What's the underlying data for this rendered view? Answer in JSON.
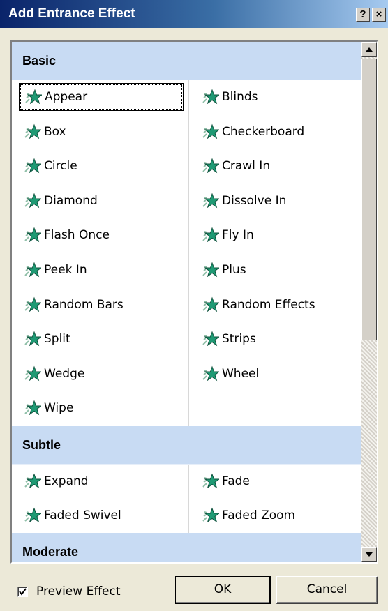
{
  "window": {
    "title": "Add Entrance Effect",
    "help_label": "?",
    "close_label": "×"
  },
  "categories": {
    "basic": "Basic",
    "subtle": "Subtle",
    "moderate": "Moderate"
  },
  "basic_effects": [
    [
      "Appear",
      "Blinds"
    ],
    [
      "Box",
      "Checkerboard"
    ],
    [
      "Circle",
      "Crawl In"
    ],
    [
      "Diamond",
      "Dissolve In"
    ],
    [
      "Flash Once",
      "Fly In"
    ],
    [
      "Peek In",
      "Plus"
    ],
    [
      "Random Bars",
      "Random Effects"
    ],
    [
      "Split",
      "Strips"
    ],
    [
      "Wedge",
      "Wheel"
    ],
    [
      "Wipe",
      ""
    ]
  ],
  "subtle_effects": [
    [
      "Expand",
      "Fade"
    ],
    [
      "Faded Swivel",
      "Faded Zoom"
    ]
  ],
  "selected_effect": "Appear",
  "footer": {
    "preview_label": "Preview Effect",
    "preview_checked": true,
    "ok_label": "OK",
    "cancel_label": "Cancel"
  },
  "colors": {
    "title_gradient_start": "#0a246a",
    "category_band": "#c8dbf3",
    "star_fill": "#1f9a74"
  }
}
